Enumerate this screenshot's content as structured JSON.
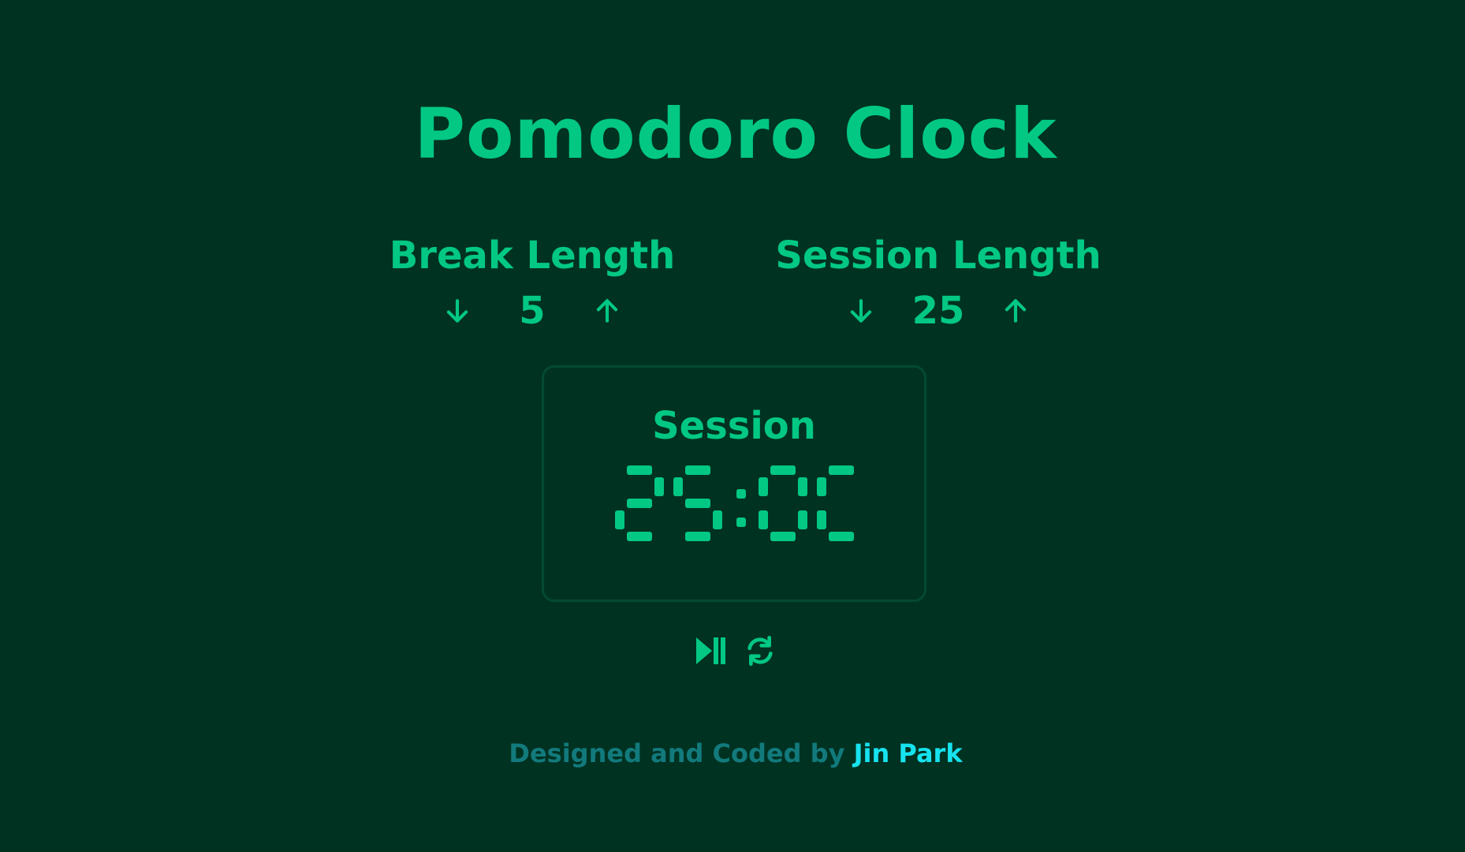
{
  "title": "Pomodoro Clock",
  "break": {
    "label": "Break Length",
    "value": "5",
    "decrement_icon": "arrow-down-icon",
    "increment_icon": "arrow-up-icon"
  },
  "session": {
    "label": "Session Length",
    "value": "25",
    "decrement_icon": "arrow-down-icon",
    "increment_icon": "arrow-up-icon"
  },
  "timer": {
    "label": "Session",
    "time": "25:00"
  },
  "actions": {
    "play_pause_icon": "play-pause-icon",
    "reset_icon": "refresh-icon"
  },
  "footer": {
    "text": "Designed and Coded by ",
    "author": "Jin Park"
  },
  "colors": {
    "background": "#003222",
    "accent": "#02c883",
    "footer_text": "#127a7c",
    "footer_link": "#16e3ee",
    "timer_border": "#034a31"
  }
}
